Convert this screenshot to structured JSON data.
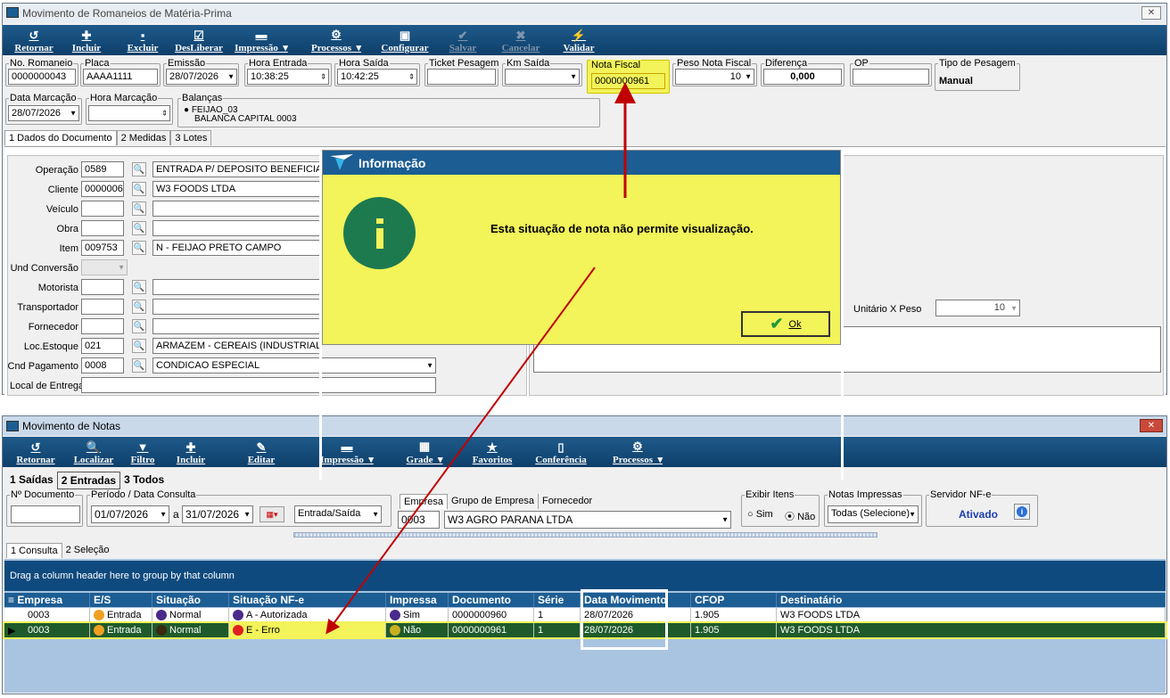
{
  "win1": {
    "title": "Movimento de Romaneios de Matéria-Prima",
    "close": "✕",
    "toolbar": [
      {
        "label": "Retornar",
        "icon": "↺",
        "disabled": false
      },
      {
        "label": "Incluir",
        "icon": "✚",
        "disabled": false
      },
      {
        "label": "Excluir",
        "icon": "▪",
        "disabled": false
      },
      {
        "label": "DesLiberar",
        "icon": "☑",
        "disabled": false
      },
      {
        "label": "Impressão",
        "icon": "▬",
        "disabled": false,
        "caret": true
      },
      {
        "label": "Processos",
        "icon": "⚙",
        "disabled": false,
        "caret": true
      },
      {
        "label": "Configurar",
        "icon": "▣",
        "disabled": false
      },
      {
        "label": "Salvar",
        "icon": "✔",
        "disabled": true
      },
      {
        "label": "Cancelar",
        "icon": "✖",
        "disabled": true
      },
      {
        "label": "Validar",
        "icon": "⚡",
        "disabled": false
      }
    ],
    "fields": {
      "no_romaneio_label": "No. Romaneio",
      "no_romaneio": "0000000043",
      "placa_label": "Placa",
      "placa": "AAAA1111",
      "emissao_label": "Emissão",
      "emissao": "28/07/2026",
      "hora_entrada_label": "Hora Entrada",
      "hora_entrada": "10:38:25",
      "hora_saida_label": "Hora Saída",
      "hora_saida": "10:42:25",
      "ticket_label": "Ticket Pesagem",
      "ticket": "",
      "km_label": "Km Saída",
      "km": "",
      "nota_label": "Nota Fiscal",
      "nota": "0000000961",
      "peso_label": "Peso Nota Fiscal",
      "peso": "10",
      "diferenca_label": "Diferença",
      "diferenca": "0,000",
      "op_label": "OP",
      "op": "",
      "tipo_label": "Tipo de Pesagem",
      "tipo": "Manual",
      "data_marc_label": "Data Marcação",
      "data_marc": "28/07/2026",
      "hora_marc_label": "Hora Marcação",
      "hora_marc": "",
      "balancas_label": "Balanças",
      "balanca1": "FEIJAO_03",
      "balanca2": "BALANCA CAPITAL  0003"
    },
    "tabs": [
      "1 Dados do Documento",
      "2 Medidas",
      "3 Lotes"
    ],
    "form": {
      "operacao_label": "Operação",
      "operacao_code": "0589",
      "operacao_desc": "ENTRADA P/ DEPOSITO BENEFICIAM",
      "cliente_label": "Cliente",
      "cliente_code": "0000006",
      "cliente_desc": "W3 FOODS LTDA",
      "veiculo_label": "Veículo",
      "obra_label": "Obra",
      "item_label": "Item",
      "item_code": "009753",
      "item_desc": "N - FEIJAO PRETO CAMPO",
      "und_label": "Und Conversão",
      "motorista_label": "Motorista",
      "transportador_label": "Transportador",
      "fornecedor_label": "Fornecedor",
      "loc_label": "Loc.Estoque",
      "loc_code": "021",
      "loc_desc": "ARMAZEM - CEREAIS (INDUSTRIAL) -",
      "cnd_label": "Cnd Pagamento",
      "cnd_code": "0008",
      "cnd_desc": "CONDICAO ESPECIAL",
      "local_label": "Local de Entrega",
      "unit_label": "Unitário X Peso",
      "unit_val": "10"
    }
  },
  "dialog": {
    "title": "Informação",
    "message": "Esta situação de nota não permite visualização.",
    "ok": "Ok"
  },
  "win2": {
    "title": "Movimento de Notas",
    "close": "✕",
    "toolbar": [
      {
        "label": "Retornar",
        "icon": "↺"
      },
      {
        "label": "Localizar",
        "icon": "🔍"
      },
      {
        "label": "Filtro",
        "icon": "▼"
      },
      {
        "label": "Incluir",
        "icon": "✚"
      },
      {
        "label": "Editar",
        "icon": "✎"
      },
      {
        "label": "Impressão",
        "icon": "▬",
        "caret": true
      },
      {
        "label": "Grade",
        "icon": "▦",
        "caret": true
      },
      {
        "label": "Favoritos",
        "icon": "★"
      },
      {
        "label": "Conferência",
        "icon": "▯"
      },
      {
        "label": "Processos",
        "icon": "⚙",
        "caret": true
      }
    ],
    "tabs": [
      "1 Saídas",
      "2 Entradas",
      "3 Todos"
    ],
    "filters": {
      "doc_label": "Nº Documento",
      "doc": "",
      "periodo_label": "Período / Data Consulta",
      "from": "01/07/2026",
      "a": "a",
      "to": "31/07/2026",
      "es": "Entrada/Saída",
      "emp_tabs": [
        "Empresa",
        "Grupo de Empresa",
        "Fornecedor"
      ],
      "emp_code": "0003",
      "emp_desc": "W3 AGRO PARANA LTDA",
      "exibir_label": "Exibir Itens",
      "sim": "Sim",
      "nao": "Não",
      "notas_label": "Notas Impressas",
      "notas": "Todas (Selecione)",
      "nfe_label": "Servidor NF-e",
      "nfe": "Ativado"
    },
    "subtabs": [
      "1 Consulta",
      "2 Seleção"
    ],
    "group_hint": "Drag a column header here to group by that column",
    "columns": [
      "Empresa",
      "E/S",
      "Situação",
      "Situação NF-e",
      "Impressa",
      "Documento",
      "Série",
      "Data Movimento",
      "CFOP",
      "Destinatário"
    ],
    "rows": [
      {
        "empresa": "0003",
        "es": "Entrada",
        "sit": "Normal",
        "nfe": "A - Autorizada",
        "imp": "Sim",
        "doc": "0000000960",
        "serie": "1",
        "data": "28/07/2026",
        "cfop": "1.905",
        "dest": "W3 FOODS LTDA"
      },
      {
        "empresa": "0003",
        "es": "Entrada",
        "sit": "Normal",
        "nfe": "E - Erro",
        "imp": "Não",
        "doc": "0000000961",
        "serie": "1",
        "data": "28/07/2026",
        "cfop": "1.905",
        "dest": "W3 FOODS LTDA"
      }
    ]
  },
  "colors": {
    "toolbar": "#1c5d93",
    "highlight": "#f3f35a",
    "dialog_title": "#1c5d93",
    "arrow": "#c00000"
  }
}
